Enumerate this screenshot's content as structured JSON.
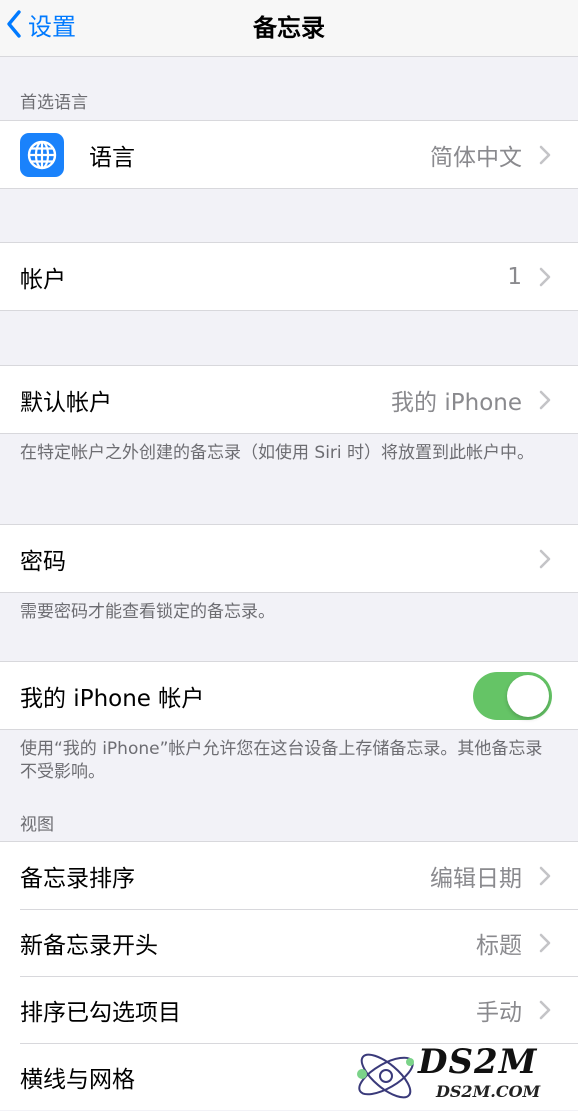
{
  "nav": {
    "back_label": "设置",
    "title": "备忘录"
  },
  "sections": {
    "preferred_language_header": "首选语言",
    "view_header": "视图"
  },
  "language_row": {
    "label": "语言",
    "value": "简体中文",
    "icon": "globe-icon"
  },
  "accounts_row": {
    "label": "帐户",
    "value": "1"
  },
  "default_account_row": {
    "label": "默认帐户",
    "value": "我的 iPhone"
  },
  "default_account_footer": "在特定帐户之外创建的备忘录（如使用 Siri 时）将放置到此帐户中。",
  "password_row": {
    "label": "密码"
  },
  "password_footer": "需要密码才能查看锁定的备忘录。",
  "iphone_account_row": {
    "label": "我的 iPhone 帐户",
    "toggle_on": true
  },
  "iphone_account_footer": "使用“我的 iPhone”帐户允许您在这台设备上存储备忘录。其他备忘录不受影响。",
  "view_rows": [
    {
      "label": "备忘录排序",
      "value": "编辑日期"
    },
    {
      "label": "新备忘录开头",
      "value": "标题"
    },
    {
      "label": "排序已勾选项目",
      "value": "手动"
    },
    {
      "label": "横线与网格",
      "value": ""
    }
  ],
  "watermark": {
    "big": "DS2M",
    "small": "DS2M.COM"
  },
  "colors": {
    "accent": "#007aff",
    "toggle_on": "#65c466",
    "icon_bg": "#1a82fb"
  }
}
